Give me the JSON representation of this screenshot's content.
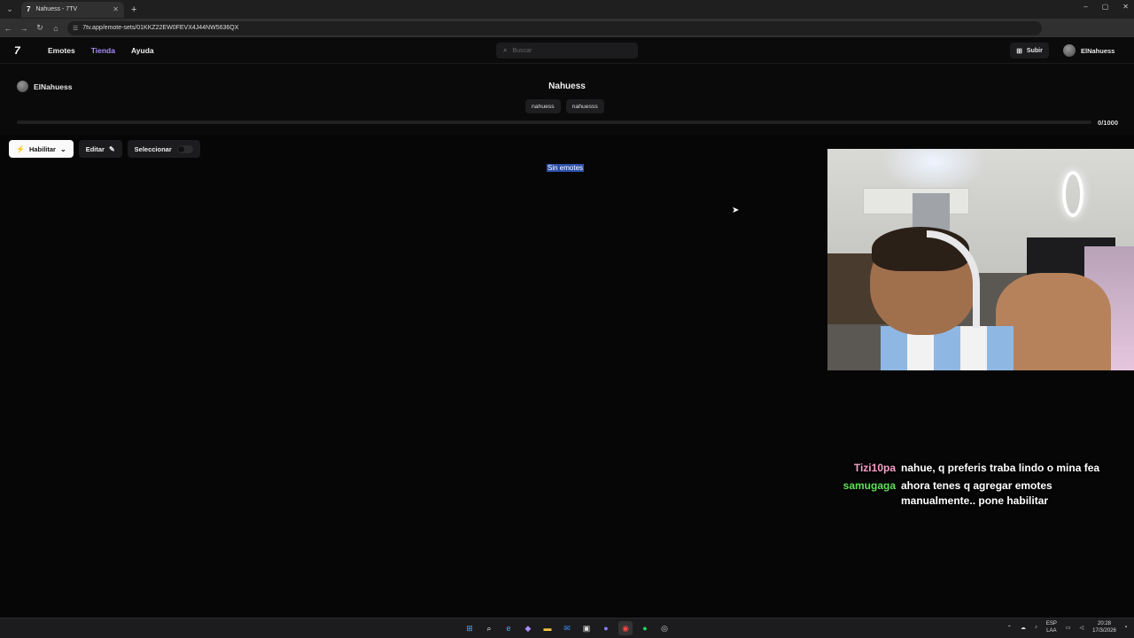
{
  "browser": {
    "tab_title": "Nahuess - 7TV",
    "tab_favicon": "7",
    "url": "7tv.app/emote-sets/01KKZ22EW0FEVX4J44NW5636QX",
    "new_tab": "+",
    "close_tab": "✕",
    "window_controls": [
      "–",
      "▢",
      "✕"
    ]
  },
  "header": {
    "logo": "7",
    "nav": [
      "Emotes",
      "Tienda",
      "Ayuda"
    ],
    "active_nav": "Tienda",
    "search_placeholder": "Buscar",
    "upload_label": "Subir",
    "username": "ElNahuess",
    "colors": {
      "accent": "#a78bfa"
    }
  },
  "emote_set": {
    "owner": "ElNahuess",
    "name": "Nahuess",
    "tags": [
      "nahuess",
      "nahuesss"
    ],
    "capacity_text": "0/1000",
    "capacity_fraction": 0
  },
  "toolbar": {
    "enable_label": "Habilitar",
    "edit_label": "Editar",
    "select_label": "Seleccionar",
    "select_toggle_on": false
  },
  "main": {
    "empty_text": "Sin emotes"
  },
  "chat": [
    {
      "user": "Tizi10pa",
      "color": "#f5a3c7",
      "message": "nahue, q preferis traba lindo o mina fea"
    },
    {
      "user": "samugaga",
      "color": "#62e15a",
      "message": "ahora tenes q agregar emotes manualmente.. pone habilitar"
    }
  ],
  "taskbar": {
    "lang_top": "ESP",
    "lang_bottom": "LAA",
    "time": "20:28",
    "date": "17/3/2026"
  }
}
